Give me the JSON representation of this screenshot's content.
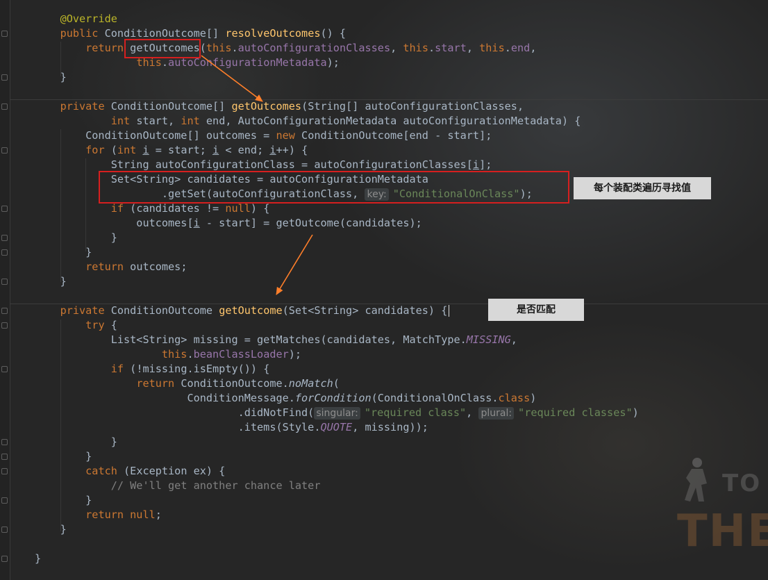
{
  "code_lines": [
    {
      "id": "l1",
      "segs": [
        {
          "t": "    "
        },
        {
          "t": "@Override",
          "c": "ann"
        }
      ]
    },
    {
      "id": "l2",
      "segs": [
        {
          "t": "    "
        },
        {
          "t": "public ",
          "c": "kw"
        },
        {
          "t": "ConditionOutcome[] "
        },
        {
          "t": "resolveOutcomes",
          "c": "fn"
        },
        {
          "t": "() {"
        }
      ]
    },
    {
      "id": "l3",
      "segs": [
        {
          "t": "        "
        },
        {
          "t": "return ",
          "c": "kw"
        },
        {
          "t": "getOutcomes("
        },
        {
          "t": "this",
          "c": "kw"
        },
        {
          "t": "."
        },
        {
          "t": "autoConfigurationClasses",
          "c": "fld"
        },
        {
          "t": ", "
        },
        {
          "t": "this",
          "c": "kw"
        },
        {
          "t": "."
        },
        {
          "t": "start",
          "c": "fld"
        },
        {
          "t": ", "
        },
        {
          "t": "this",
          "c": "kw"
        },
        {
          "t": "."
        },
        {
          "t": "end",
          "c": "fld"
        },
        {
          "t": ","
        }
      ]
    },
    {
      "id": "l4",
      "segs": [
        {
          "t": "                "
        },
        {
          "t": "this",
          "c": "kw"
        },
        {
          "t": "."
        },
        {
          "t": "autoConfigurationMetadata",
          "c": "fld"
        },
        {
          "t": ");"
        }
      ]
    },
    {
      "id": "l5",
      "segs": [
        {
          "t": "    }"
        }
      ]
    },
    {
      "id": "l6",
      "segs": []
    },
    {
      "id": "l7",
      "segs": [
        {
          "t": "    "
        },
        {
          "t": "private ",
          "c": "kw"
        },
        {
          "t": "ConditionOutcome[] "
        },
        {
          "t": "getOutcomes",
          "c": "fn"
        },
        {
          "t": "(String[] autoConfigurationClasses,"
        }
      ]
    },
    {
      "id": "l8",
      "segs": [
        {
          "t": "            "
        },
        {
          "t": "int ",
          "c": "kw"
        },
        {
          "t": "start, "
        },
        {
          "t": "int ",
          "c": "kw"
        },
        {
          "t": "end, AutoConfigurationMetadata autoConfigurationMetadata) {"
        }
      ]
    },
    {
      "id": "l9",
      "segs": [
        {
          "t": "        ConditionOutcome[] outcomes = "
        },
        {
          "t": "new ",
          "c": "kw"
        },
        {
          "t": "ConditionOutcome[end - start];"
        }
      ]
    },
    {
      "id": "l10",
      "segs": [
        {
          "t": "        "
        },
        {
          "t": "for ",
          "c": "kw"
        },
        {
          "t": "("
        },
        {
          "t": "int ",
          "c": "kw"
        },
        {
          "t": "i",
          "c": "ul"
        },
        {
          "t": " = start; "
        },
        {
          "t": "i",
          "c": "ul"
        },
        {
          "t": " < end; "
        },
        {
          "t": "i",
          "c": "ul"
        },
        {
          "t": "++) {"
        }
      ]
    },
    {
      "id": "l11",
      "segs": [
        {
          "t": "            String autoConfigurationClass = autoConfigurationClasses["
        },
        {
          "t": "i",
          "c": "ul"
        },
        {
          "t": "];"
        }
      ]
    },
    {
      "id": "l12",
      "segs": [
        {
          "t": "            Set<String> candidates = autoConfigurationMetadata"
        }
      ]
    },
    {
      "id": "l13",
      "segs": [
        {
          "t": "                    .getSet(autoConfigurationClass, "
        },
        {
          "t": "key:",
          "c": "hint"
        },
        {
          "t": "\"ConditionalOnClass\"",
          "c": "str"
        },
        {
          "t": ");"
        }
      ]
    },
    {
      "id": "l14",
      "segs": [
        {
          "t": "            "
        },
        {
          "t": "if ",
          "c": "kw"
        },
        {
          "t": "(candidates != "
        },
        {
          "t": "null",
          "c": "kw"
        },
        {
          "t": ") {"
        }
      ]
    },
    {
      "id": "l15",
      "segs": [
        {
          "t": "                outcomes["
        },
        {
          "t": "i",
          "c": "ul"
        },
        {
          "t": " - start] = getOutcome(candidates);"
        }
      ]
    },
    {
      "id": "l16",
      "segs": [
        {
          "t": "            }"
        }
      ]
    },
    {
      "id": "l17",
      "segs": [
        {
          "t": "        }"
        }
      ]
    },
    {
      "id": "l18",
      "segs": [
        {
          "t": "        "
        },
        {
          "t": "return ",
          "c": "kw"
        },
        {
          "t": "outcomes;"
        }
      ]
    },
    {
      "id": "l19",
      "segs": [
        {
          "t": "    }"
        }
      ]
    },
    {
      "id": "l20",
      "segs": []
    },
    {
      "id": "l21",
      "segs": [
        {
          "t": "    "
        },
        {
          "t": "private ",
          "c": "kw"
        },
        {
          "t": "ConditionOutcome "
        },
        {
          "t": "getOutcome",
          "c": "fn"
        },
        {
          "t": "(Set<String> candidates) {"
        }
      ],
      "caret_after": true
    },
    {
      "id": "l22",
      "segs": [
        {
          "t": "        "
        },
        {
          "t": "try ",
          "c": "kw"
        },
        {
          "t": "{"
        }
      ]
    },
    {
      "id": "l23",
      "segs": [
        {
          "t": "            List<String> missing = getMatches(candidates, MatchType."
        },
        {
          "t": "MISSING",
          "c": "ital"
        },
        {
          "t": ","
        }
      ]
    },
    {
      "id": "l24",
      "segs": [
        {
          "t": "                    "
        },
        {
          "t": "this",
          "c": "kw"
        },
        {
          "t": "."
        },
        {
          "t": "beanClassLoader",
          "c": "fld"
        },
        {
          "t": ");"
        }
      ]
    },
    {
      "id": "l25",
      "segs": [
        {
          "t": "            "
        },
        {
          "t": "if ",
          "c": "kw"
        },
        {
          "t": "(!missing.isEmpty()) {"
        }
      ]
    },
    {
      "id": "l26",
      "segs": [
        {
          "t": "                "
        },
        {
          "t": "return ",
          "c": "kw"
        },
        {
          "t": "ConditionOutcome."
        },
        {
          "t": "noMatch",
          "c": "itfn"
        },
        {
          "t": "("
        }
      ]
    },
    {
      "id": "l27",
      "segs": [
        {
          "t": "                        ConditionMessage."
        },
        {
          "t": "forCondition",
          "c": "itfn"
        },
        {
          "t": "(ConditionalOnClass."
        },
        {
          "t": "class",
          "c": "kw"
        },
        {
          "t": ")"
        }
      ]
    },
    {
      "id": "l28",
      "segs": [
        {
          "t": "                                .didNotFind("
        },
        {
          "t": "singular:",
          "c": "hint"
        },
        {
          "t": "\"required class\"",
          "c": "str"
        },
        {
          "t": ", "
        },
        {
          "t": "plural:",
          "c": "hint"
        },
        {
          "t": "\"required classes\"",
          "c": "str"
        },
        {
          "t": ")"
        }
      ]
    },
    {
      "id": "l29",
      "segs": [
        {
          "t": "                                .items(Style."
        },
        {
          "t": "QUOTE",
          "c": "ital"
        },
        {
          "t": ", missing));"
        }
      ]
    },
    {
      "id": "l30",
      "segs": [
        {
          "t": "            }"
        }
      ]
    },
    {
      "id": "l31",
      "segs": [
        {
          "t": "        }"
        }
      ]
    },
    {
      "id": "l32",
      "segs": [
        {
          "t": "        "
        },
        {
          "t": "catch ",
          "c": "kw"
        },
        {
          "t": "(Exception ex) {"
        }
      ]
    },
    {
      "id": "l33",
      "segs": [
        {
          "t": "            "
        },
        {
          "t": "// We'll get another chance later",
          "c": "cm"
        }
      ]
    },
    {
      "id": "l34",
      "segs": [
        {
          "t": "        }"
        }
      ]
    },
    {
      "id": "l35",
      "segs": [
        {
          "t": "        "
        },
        {
          "t": "return null",
          "c": "kw"
        },
        {
          "t": ";"
        }
      ]
    },
    {
      "id": "l36",
      "segs": [
        {
          "t": "    }"
        }
      ]
    },
    {
      "id": "l37",
      "segs": []
    },
    {
      "id": "l38",
      "segs": [
        {
          "t": "}"
        }
      ]
    }
  ],
  "annotations": {
    "note_1": "每个装配类遍历寻找值",
    "note_2": "是否匹配"
  },
  "watermark": {
    "line_1": "TO",
    "line_2": "THE"
  },
  "colors": {
    "keyword": "#cc7832",
    "annotation": "#bbb529",
    "method_decl": "#ffc66d",
    "field": "#9876aa",
    "string": "#6a8759",
    "comment": "#808080",
    "text": "#a9b7c6",
    "highlight_box": "#d61f1f",
    "arrow": "#ff7f2a",
    "note_bg": "#d8d8d8"
  }
}
